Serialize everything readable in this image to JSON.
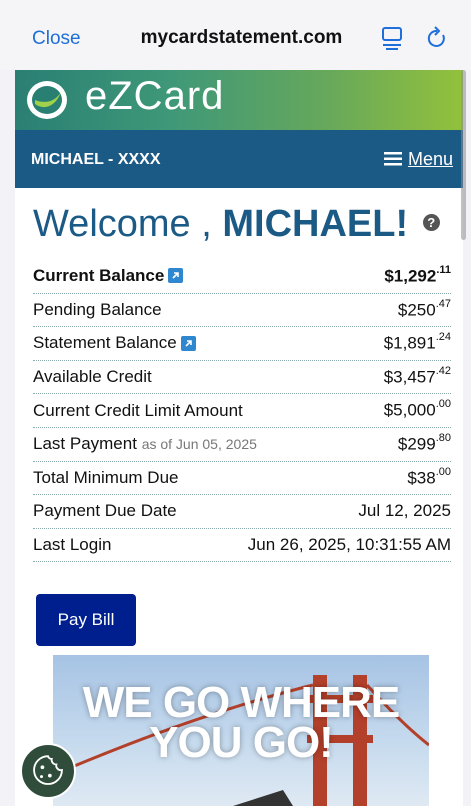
{
  "browser": {
    "close_label": "Close",
    "url": "mycardstatement.com"
  },
  "brand": {
    "logo_text": "eZCard",
    "accent": "#1c5a86",
    "gradient_start": "#2a7f73",
    "gradient_end": "#93c13c"
  },
  "nav": {
    "account": "MICHAEL - XXXX",
    "menu_label": "Menu"
  },
  "welcome": {
    "greeting": "Welcome , ",
    "name": "MICHAEL!"
  },
  "summary": [
    {
      "label": "Current Balance",
      "dollars": "$1,292",
      "cents": ".11"
    },
    {
      "label": "Pending Balance",
      "dollars": "$250",
      "cents": ".47"
    },
    {
      "label": "Statement Balance",
      "dollars": "$1,891",
      "cents": ".24"
    },
    {
      "label": "Available Credit",
      "dollars": "$3,457",
      "cents": ".42"
    },
    {
      "label": "Current Credit Limit Amount",
      "dollars": "$5,000",
      "cents": ".00"
    },
    {
      "label": "Last Payment",
      "asof": "as of Jun 05, 2025",
      "dollars": "$299",
      "cents": ".80"
    },
    {
      "label": "Total Minimum Due",
      "dollars": "$38",
      "cents": ".00"
    },
    {
      "label": "Payment Due Date",
      "value": "Jul 12, 2025"
    },
    {
      "label": "Last Login",
      "value": "Jun 26, 2025, 10:31:55 AM"
    }
  ],
  "actions": {
    "pay_bill": "Pay Bill"
  },
  "promo": {
    "line1": "WE GO WHERE",
    "line2": "YOU GO!"
  },
  "icons": {
    "reader": "reader-mode-icon",
    "reload": "reload-icon",
    "menu": "hamburger-icon",
    "help": "help-icon",
    "external": "external-link-icon",
    "cookie": "cookie-settings-icon"
  }
}
